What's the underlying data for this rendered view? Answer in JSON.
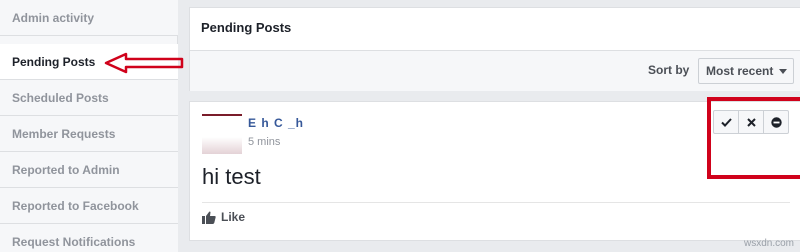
{
  "sidebar": {
    "items": [
      {
        "label": "Admin activity",
        "active": false
      },
      {
        "label": "Pending Posts",
        "active": true
      },
      {
        "label": "Scheduled Posts",
        "active": false
      },
      {
        "label": "Member Requests",
        "active": false
      },
      {
        "label": "Reported to Admin",
        "active": false
      },
      {
        "label": "Reported to Facebook",
        "active": false
      },
      {
        "label": "Request Notifications",
        "active": false
      }
    ]
  },
  "header": {
    "title": "Pending Posts",
    "sort_label": "Sort by",
    "sort_value": "Most recent"
  },
  "post": {
    "author": "E   h  C   _h",
    "timestamp": "5 mins",
    "text": "hi test",
    "like_label": "Like"
  },
  "moderation": {
    "icons": [
      "check-icon",
      "close-icon",
      "remove-icon"
    ]
  },
  "colors": {
    "annotation": "#d0021b",
    "link": "#365899",
    "background": "#e9ebee"
  },
  "watermark": "wsxdn.com"
}
